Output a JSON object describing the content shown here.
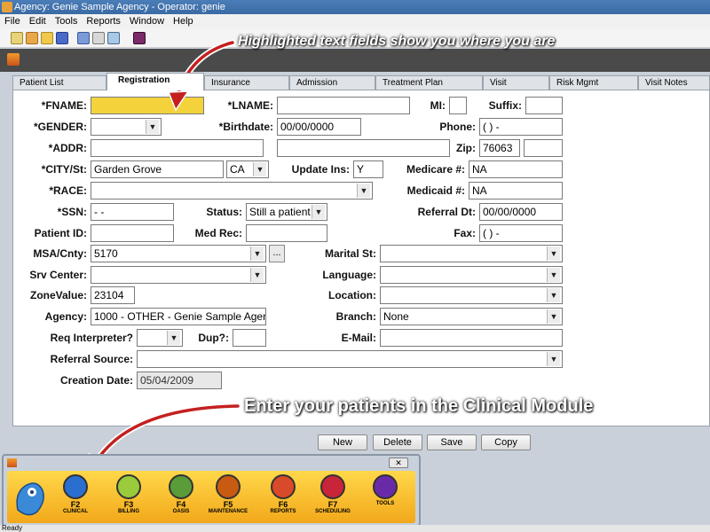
{
  "window": {
    "title": "Agency: Genie Sample Agency - Operator: genie"
  },
  "menu": [
    "File",
    "Edit",
    "Tools",
    "Reports",
    "Window",
    "Help"
  ],
  "annotations": {
    "top": "Highlighted text fields show you where you are",
    "bottom": "Enter your patients in the Clinical Module"
  },
  "tabs": [
    "Patient List",
    "Registration",
    "Insurance",
    "Admission",
    "Treatment Plan",
    "Visit",
    "Risk Mgmt",
    "Visit Notes"
  ],
  "form": {
    "fname_label": "*FNAME:",
    "fname": "",
    "lname_label": "*LNAME:",
    "lname": "",
    "mi_label": "MI:",
    "mi": "",
    "suffix_label": "Suffix:",
    "suffix": "",
    "gender_label": "*GENDER:",
    "gender": "",
    "birthdate_label": "*Birthdate:",
    "birthdate": "00/00/0000",
    "phone_label": "Phone:",
    "phone": "(   )    -",
    "addr_label": "*ADDR:",
    "addr1": "",
    "addr2": "",
    "zip_label": "Zip:",
    "zip": "76063",
    "zip_ext": "",
    "city_label": "*CITY/St:",
    "city": "Garden Grove",
    "state": "CA",
    "update_ins_label": "Update Ins:",
    "update_ins": "Y",
    "medicare_label": "Medicare #:",
    "medicare": "NA",
    "race_label": "*RACE:",
    "race": "",
    "medicaid_label": "Medicaid #:",
    "medicaid": "NA",
    "ssn_label": "*SSN:",
    "ssn": "  -  -",
    "status_label": "Status:",
    "status": "Still a patient",
    "referral_dt_label": "Referral Dt:",
    "referral_dt": "00/00/0000",
    "patient_id_label": "Patient ID:",
    "patient_id": "",
    "med_rec_label": "Med Rec:",
    "med_rec": "",
    "fax_label": "Fax:",
    "fax": "(   )    -",
    "msa_label": "MSA/Cnty:",
    "msa": "5170",
    "ellipsis": "...",
    "marital_label": "Marital St:",
    "marital": "",
    "srv_center_label": "Srv Center:",
    "srv_center": "",
    "language_label": "Language:",
    "language": "",
    "zonevalue_label": "ZoneValue:",
    "zonevalue": "23104",
    "location_label": "Location:",
    "location": "",
    "agency_label": "Agency:",
    "agency": "1000 - OTHER - Genie Sample Agency",
    "branch_label": "Branch:",
    "branch": "None",
    "req_interp_label": "Req Interpreter?",
    "req_interp": "",
    "dup_label": "Dup?:",
    "dup": "",
    "email_label": "E-Mail:",
    "email": "",
    "referral_source_label": "Referral Source:",
    "referral_source": "",
    "creation_date_label": "Creation Date:",
    "creation_date": "05/04/2009"
  },
  "buttons": {
    "new": "New",
    "delete": "Delete",
    "save": "Save",
    "copy": "Copy"
  },
  "modules": [
    {
      "key": "F2",
      "name": "CLINICAL",
      "icon": "clinical-icon",
      "color": "#2a6fd0"
    },
    {
      "key": "F3",
      "name": "BILLING",
      "icon": "billing-icon",
      "color": "#9acb3c"
    },
    {
      "key": "F4",
      "name": "OASIS",
      "icon": "oasis-icon",
      "color": "#5a9b3a"
    },
    {
      "key": "F5",
      "name": "MAINTENANCE",
      "icon": "maintenance-icon",
      "color": "#c85a12"
    },
    {
      "key": "F6",
      "name": "REPORTS",
      "icon": "reports-icon",
      "color": "#d94a2a"
    },
    {
      "key": "F7",
      "name": "SCHEDULING",
      "icon": "scheduling-icon",
      "color": "#c8243a"
    },
    {
      "key": "",
      "name": "TOOLS",
      "icon": "tools-icon",
      "color": "#6a2aa8"
    }
  ],
  "status_bar": "Ready",
  "colors": {
    "highlight": "#f3d23c",
    "tool_bar_gold": "#f2a81a",
    "title_blue": "#3a6aa3"
  }
}
